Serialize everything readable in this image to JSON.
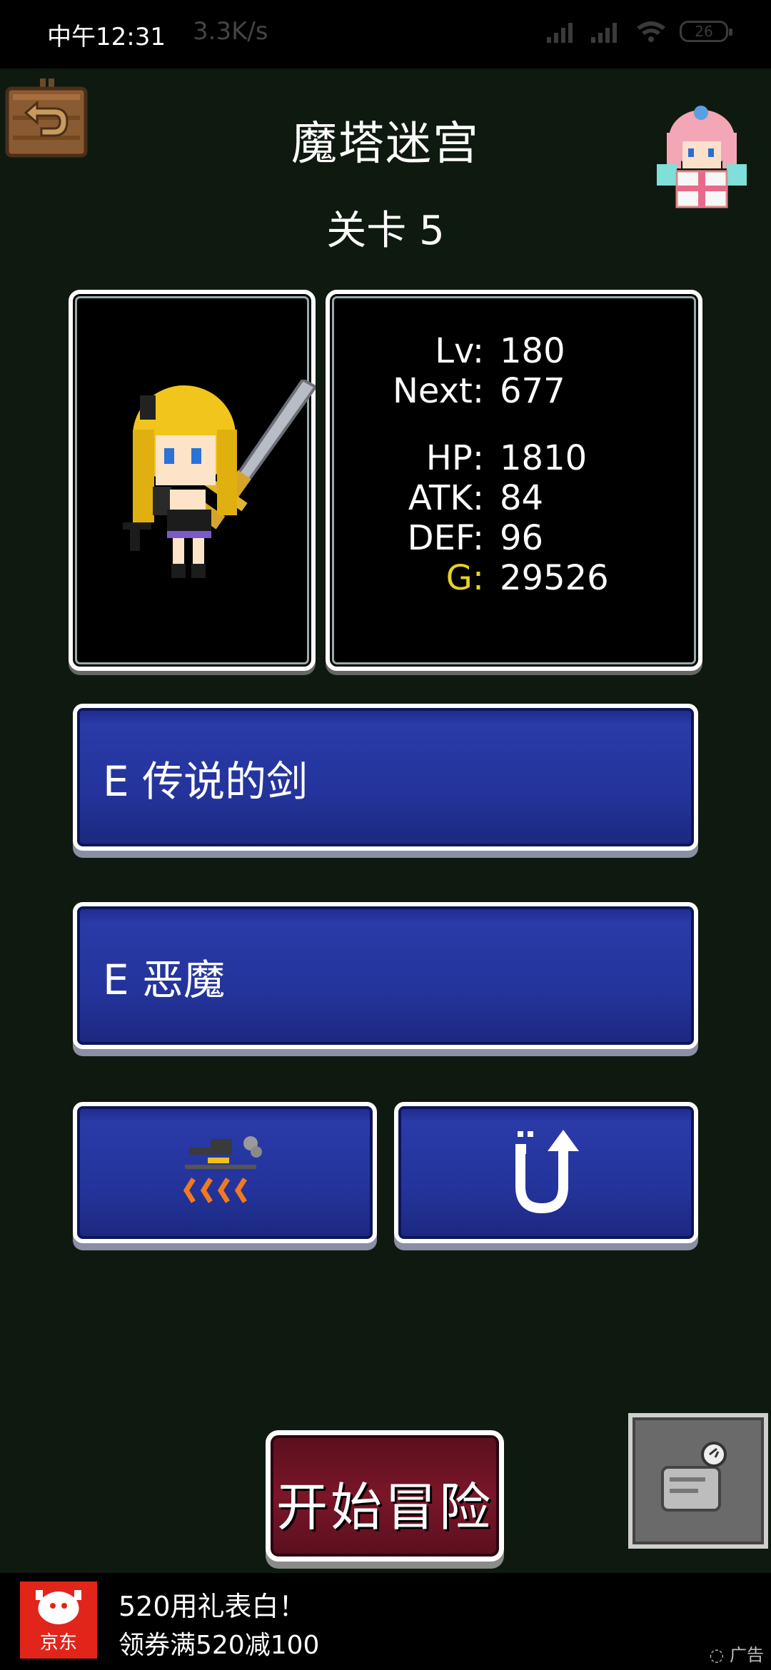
{
  "status_bar": {
    "time": "中午12:31",
    "network_speed": "3.3K/s",
    "battery": "26"
  },
  "header": {
    "title": "魔塔迷宫",
    "level": "关卡 5"
  },
  "stats": {
    "lv_label": "Lv:",
    "lv_value": "180",
    "next_label": "Next:",
    "next_value": "677",
    "hp_label": "HP:",
    "hp_value": "1810",
    "atk_label": "ATK:",
    "atk_value": "84",
    "def_label": "DEF:",
    "def_value": "96",
    "g_label": "G:",
    "g_value": "29526"
  },
  "equipment": {
    "weapon": "E 传说的剑",
    "armor": "E 恶魔"
  },
  "start_button": "开始冒险",
  "ad": {
    "logo_text": "京东",
    "title": "520用礼表白！",
    "subtitle": "领券满520减100",
    "tag": "广告"
  },
  "colors": {
    "background": "#0e1a10",
    "button_blue": "#24349c",
    "start_red": "#7a1628",
    "gold": "#e8d02a"
  }
}
